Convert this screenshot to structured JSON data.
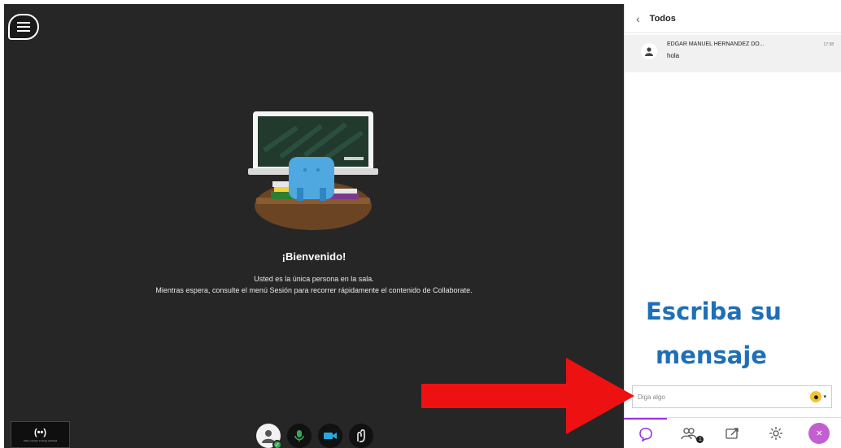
{
  "stage": {
    "welcome_title": "¡Bienvenido!",
    "info_line1": "Usted es la única persona en la sala.",
    "info_line2": "Mientras espera, consulte el menú Sesión para recorrer rápidamente el contenido de Collaborate.",
    "broadcast_icon": "(••)",
    "broadcast_text": "Video content is being watched",
    "menu_icon": "hamburger-menu-icon"
  },
  "controls": {
    "icons": [
      "avatar-icon",
      "microphone-icon",
      "camera-icon",
      "raise-hand-icon"
    ],
    "status_check": "✓"
  },
  "chat": {
    "back_icon": "‹",
    "title": "Todos",
    "message": {
      "author": "EDGAR MANUEL HERNANDEZ DO...",
      "time": "17:38",
      "text": "hola"
    },
    "input_placeholder": "Diga algo",
    "emoji": "☻",
    "emoji_caret": "▾"
  },
  "annotation": {
    "line1": "Escriba su",
    "line2": "mensaje",
    "arrow_color": "#ee1111"
  },
  "tabs": [
    {
      "name": "chat",
      "icon": "chat-bubble-icon",
      "active": true
    },
    {
      "name": "attendees",
      "icon": "attendees-icon",
      "badge": "1"
    },
    {
      "name": "share",
      "icon": "share-content-icon"
    },
    {
      "name": "settings",
      "icon": "gear-icon"
    },
    {
      "name": "close",
      "icon": "close-icon",
      "label": "×"
    }
  ],
  "colors": {
    "stage_bg": "#262626",
    "accent_purple": "#9b30d9",
    "overlay_blue": "#1e6fb8",
    "status_green": "#3aa757"
  }
}
